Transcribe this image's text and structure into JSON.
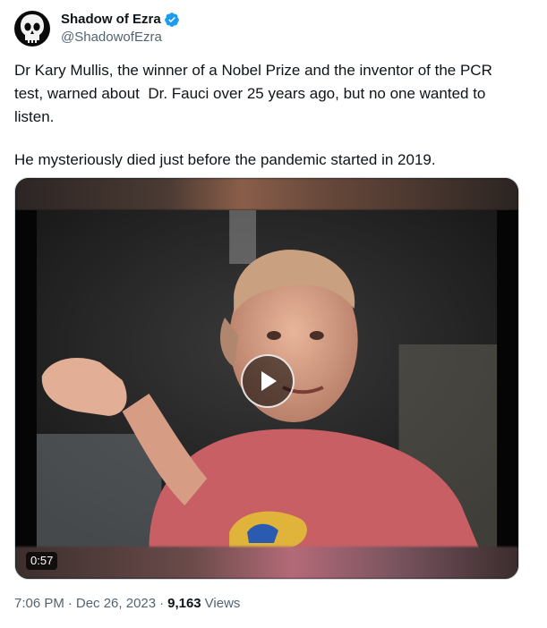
{
  "author": {
    "display_name": "Shadow of Ezra",
    "handle": "@ShadowofEzra",
    "avatar_icon": "punisher-skull-icon",
    "verified_icon": "verified-badge-icon",
    "verified_color": "#1d9bf0"
  },
  "tweet": {
    "paragraphs": [
      "Dr Kary Mullis, the winner of a Nobel Prize and the inventor of the PCR test, warned about  Dr. Fauci over 25 years ago, but no one wanted to listen.",
      "He mysteriously died just before the pandemic started in 2019."
    ]
  },
  "media": {
    "duration": "0:57",
    "play_icon": "play-icon"
  },
  "meta": {
    "time": "7:06 PM",
    "separator": "·",
    "date": "Dec 26, 2023",
    "views_count": "9,163",
    "views_label": "Views"
  },
  "colors": {
    "text_primary": "#0f1419",
    "text_secondary": "#536471",
    "accent": "#1d9bf0"
  }
}
